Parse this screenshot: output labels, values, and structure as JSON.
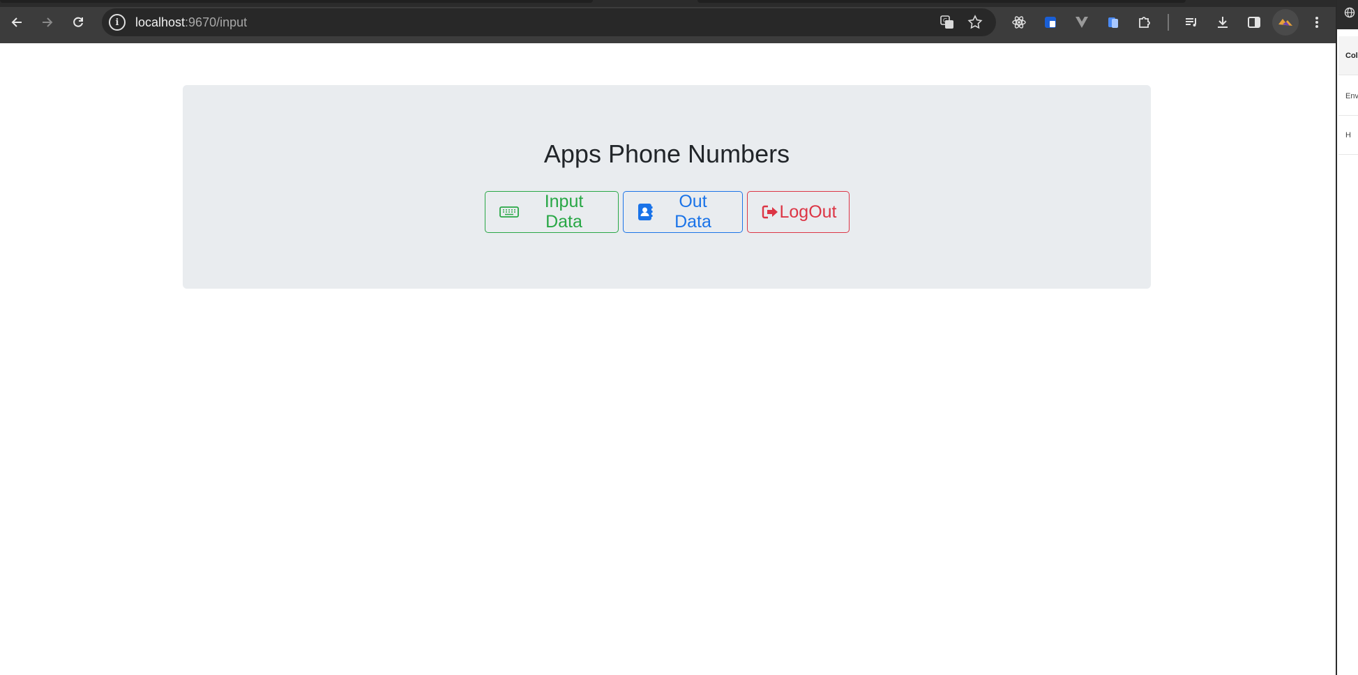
{
  "browser": {
    "url_host": "localhost",
    "url_rest": ":9670/input",
    "icons": [
      "back-icon",
      "forward-icon",
      "reload-icon",
      "site-info-icon",
      "translate-icon",
      "bookmark-star-icon",
      "react-devtools-icon",
      "extension-shield-icon",
      "vue-devtools-icon",
      "extension-docs-icon",
      "extensions-puzzle-icon",
      "reading-list-icon",
      "download-icon",
      "side-panel-icon",
      "profile-avatar",
      "menu-icon"
    ]
  },
  "side_panel": {
    "top_icon": "globe-icon",
    "items": [
      "Coll",
      "Envir",
      "H"
    ]
  },
  "page": {
    "title": "Apps Phone Numbers",
    "buttons": {
      "input": "Input Data",
      "out": "Out Data",
      "logout": "LogOut"
    }
  },
  "colors": {
    "success": "#28a745",
    "primary": "#1a73e8",
    "danger": "#dc3545",
    "jumbotron_bg": "#e9ecef"
  }
}
